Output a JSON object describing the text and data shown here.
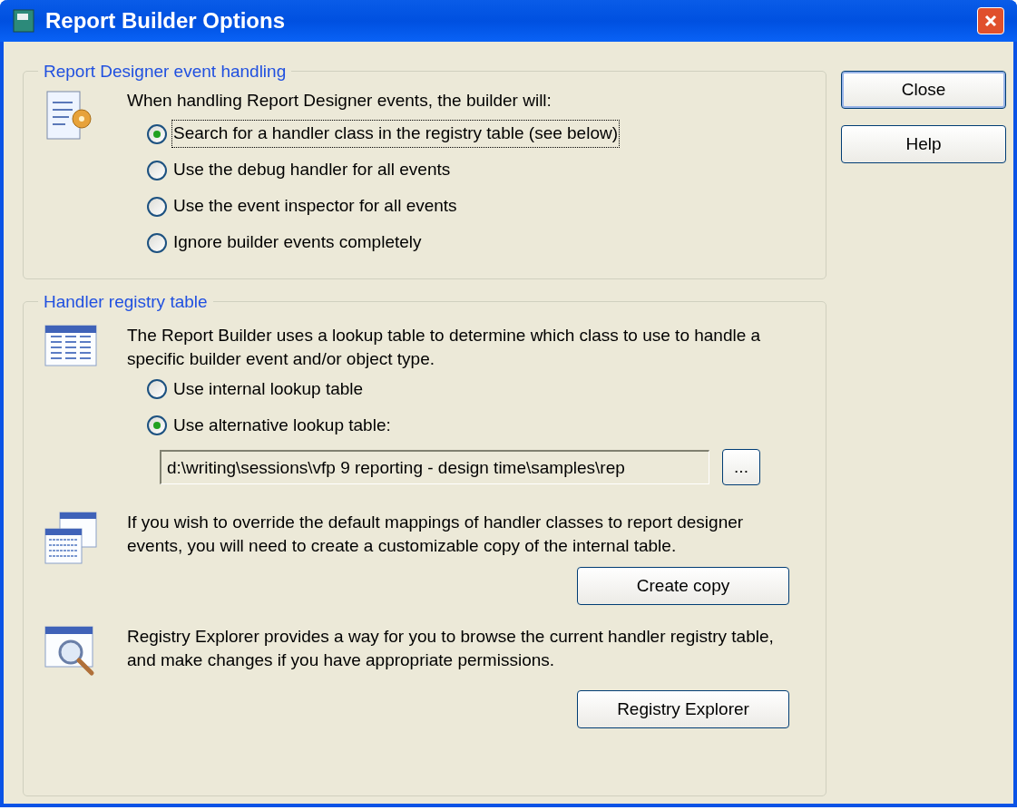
{
  "window": {
    "title": "Report Builder Options"
  },
  "event_handling": {
    "title": "Report Designer event handling",
    "prompt": "When handling Report Designer events, the builder will:",
    "options": [
      {
        "label": "Search for a handler class in the registry table (see below)",
        "selected": true,
        "focused": true
      },
      {
        "label": "Use the debug handler for all events",
        "selected": false,
        "focused": false
      },
      {
        "label": "Use the event inspector for all events",
        "selected": false,
        "focused": false
      },
      {
        "label": "Ignore builder events completely",
        "selected": false,
        "focused": false
      }
    ]
  },
  "registry": {
    "title": "Handler registry table",
    "description": "The Report Builder uses a lookup table to determine which class to use to handle a specific builder event and/or object type.",
    "options": [
      {
        "label": "Use internal lookup table",
        "selected": false,
        "focused": false
      },
      {
        "label": "Use alternative lookup table:",
        "selected": true,
        "focused": false
      }
    ],
    "path_field": {
      "value": "d:\\writing\\sessions\\vfp 9 reporting - design time\\samples\\rep"
    },
    "browse_button": "...",
    "copy_text": "If you wish to override the default mappings of handler classes to report designer events, you will need to create a customizable copy of the internal table.",
    "copy_button": "Create copy",
    "explorer_text": "Registry Explorer provides a way for you to browse the current handler registry table, and make changes if you have appropriate permissions.",
    "explorer_button": "Registry Explorer"
  },
  "buttons": [
    {
      "label": "Close",
      "default": true
    },
    {
      "label": "Help",
      "default": false
    }
  ]
}
